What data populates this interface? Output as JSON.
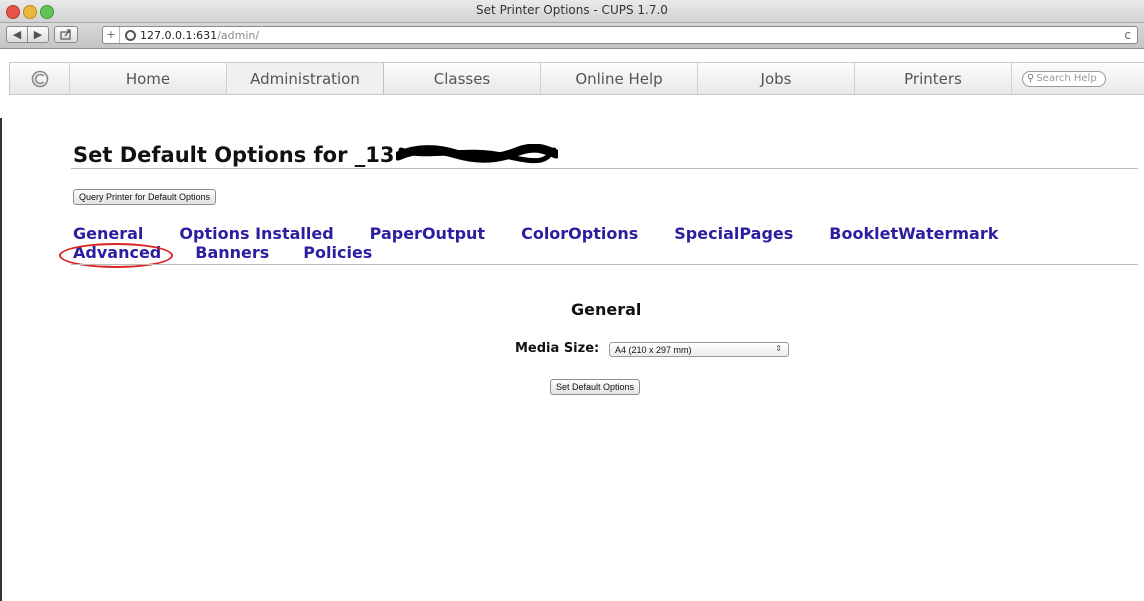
{
  "window": {
    "title": "Set Printer Options - CUPS 1.7.0"
  },
  "browser": {
    "url_host": "127.0.0.1:631",
    "url_path": "/admin/",
    "add_symbol": "+",
    "reload_symbol": "c"
  },
  "nav": {
    "tabs": [
      {
        "label": "Home"
      },
      {
        "label": "Administration"
      },
      {
        "label": "Classes"
      },
      {
        "label": "Online Help"
      },
      {
        "label": "Jobs"
      },
      {
        "label": "Printers"
      }
    ],
    "active": "Administration",
    "search_placeholder": "Search Help"
  },
  "page": {
    "title": "Set Default Options for _13",
    "query_button": "Query Printer for Default Options",
    "option_tabs_row1": [
      "General",
      "Options Installed",
      "PaperOutput",
      "ColorOptions",
      "SpecialPages",
      "BookletWatermark"
    ],
    "option_tabs_row2": [
      "Advanced",
      "Banners",
      "Policies"
    ],
    "section_heading": "General",
    "media_size_label": "Media Size:",
    "media_size_value": "A4 (210 x 297 mm)",
    "submit_button": "Set Default Options"
  },
  "colors": {
    "link": "#2b1f9f",
    "annotation_circle": "#dd2222"
  }
}
